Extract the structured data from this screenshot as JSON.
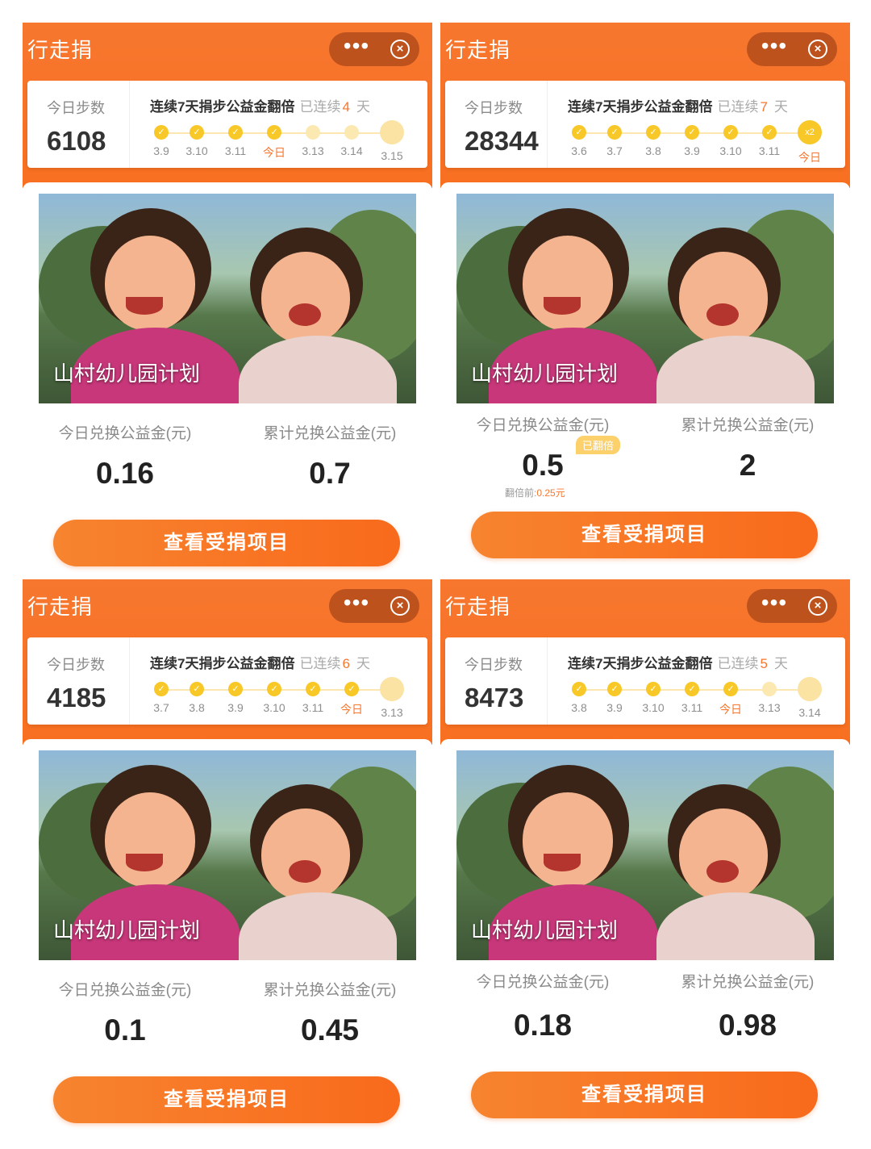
{
  "screens": [
    {
      "app_title": "行走捐",
      "steps_label": "今日步数",
      "steps": "6108",
      "streak_title": "连续7天捐步公益金翻倍",
      "streak_prefix": "已连续",
      "streak_days": "4",
      "streak_suffix": "天",
      "days": [
        {
          "label": "3.9",
          "state": "done"
        },
        {
          "label": "3.10",
          "state": "done"
        },
        {
          "label": "3.11",
          "state": "done"
        },
        {
          "label": "今日",
          "state": "today"
        },
        {
          "label": "3.13",
          "state": "future"
        },
        {
          "label": "3.14",
          "state": "future"
        },
        {
          "label": "3.15",
          "state": "goal"
        }
      ],
      "project_name": "山村幼儿园计划",
      "today_label": "今日兑换公益金(元)",
      "today_amount": "0.16",
      "total_label": "累计兑换公益金(元)",
      "total_amount": "0.7",
      "cta_label": "查看受捐项目"
    },
    {
      "app_title": "行走捐",
      "steps_label": "今日步数",
      "steps": "28344",
      "streak_title": "连续7天捐步公益金翻倍",
      "streak_prefix": "已连续",
      "streak_days": "7",
      "streak_suffix": "天",
      "days": [
        {
          "label": "3.6",
          "state": "done"
        },
        {
          "label": "3.7",
          "state": "done"
        },
        {
          "label": "3.8",
          "state": "done"
        },
        {
          "label": "3.9",
          "state": "done"
        },
        {
          "label": "3.10",
          "state": "done"
        },
        {
          "label": "3.11",
          "state": "done"
        },
        {
          "label": "今日",
          "state": "goal-today"
        }
      ],
      "goal_badge": "x2",
      "project_name": "山村幼儿园计划",
      "today_label": "今日兑换公益金(元)",
      "today_amount": "0.5",
      "doubled_badge": "已翻倍",
      "before_label": "翻倍前:",
      "before_amount": "0.25",
      "before_unit": "元",
      "total_label": "累计兑换公益金(元)",
      "total_amount": "2",
      "cta_label": "查看受捐项目"
    },
    {
      "app_title": "行走捐",
      "steps_label": "今日步数",
      "steps": "4185",
      "streak_title": "连续7天捐步公益金翻倍",
      "streak_prefix": "已连续",
      "streak_days": "6",
      "streak_suffix": "天",
      "days": [
        {
          "label": "3.7",
          "state": "done"
        },
        {
          "label": "3.8",
          "state": "done"
        },
        {
          "label": "3.9",
          "state": "done"
        },
        {
          "label": "3.10",
          "state": "done"
        },
        {
          "label": "3.11",
          "state": "done"
        },
        {
          "label": "今日",
          "state": "today"
        },
        {
          "label": "3.13",
          "state": "goal"
        }
      ],
      "project_name": "山村幼儿园计划",
      "today_label": "今日兑换公益金(元)",
      "today_amount": "0.1",
      "total_label": "累计兑换公益金(元)",
      "total_amount": "0.45",
      "cta_label": "查看受捐项目"
    },
    {
      "app_title": "行走捐",
      "steps_label": "今日步数",
      "steps": "8473",
      "streak_title": "连续7天捐步公益金翻倍",
      "streak_prefix": "已连续",
      "streak_days": "5",
      "streak_suffix": "天",
      "days": [
        {
          "label": "3.8",
          "state": "done"
        },
        {
          "label": "3.9",
          "state": "done"
        },
        {
          "label": "3.10",
          "state": "done"
        },
        {
          "label": "3.11",
          "state": "done"
        },
        {
          "label": "今日",
          "state": "today"
        },
        {
          "label": "3.13",
          "state": "future"
        },
        {
          "label": "3.14",
          "state": "goal"
        }
      ],
      "project_name": "山村幼儿园计划",
      "today_label": "今日兑换公益金(元)",
      "today_amount": "0.18",
      "total_label": "累计兑换公益金(元)",
      "total_amount": "0.98",
      "cta_label": "查看受捐项目"
    }
  ],
  "icons": {
    "more": "more-dots-icon",
    "close": "close-circle-icon",
    "day_done": "check-coin-icon"
  },
  "colors": {
    "brand_orange": "#f7772f",
    "coin_yellow": "#f8c829",
    "coin_pending": "#fbe9b1"
  }
}
